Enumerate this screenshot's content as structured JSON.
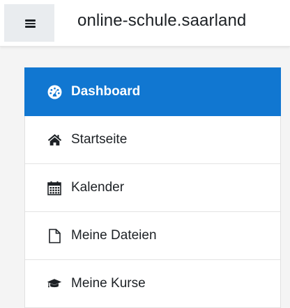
{
  "header": {
    "menu_icon": "hamburger-icon",
    "site_name": "online-schule.saarland"
  },
  "nav": {
    "accent_color": "#1177d1",
    "items": [
      {
        "label": "Dashboard",
        "icon": "dashboard-icon",
        "active": true
      },
      {
        "label": "Startseite",
        "icon": "home-icon",
        "active": false
      },
      {
        "label": "Kalender",
        "icon": "calendar-icon",
        "active": false
      },
      {
        "label": "Meine Dateien",
        "icon": "file-icon",
        "active": false
      },
      {
        "label": "Meine Kurse",
        "icon": "graduation-cap-icon",
        "active": false
      }
    ]
  }
}
